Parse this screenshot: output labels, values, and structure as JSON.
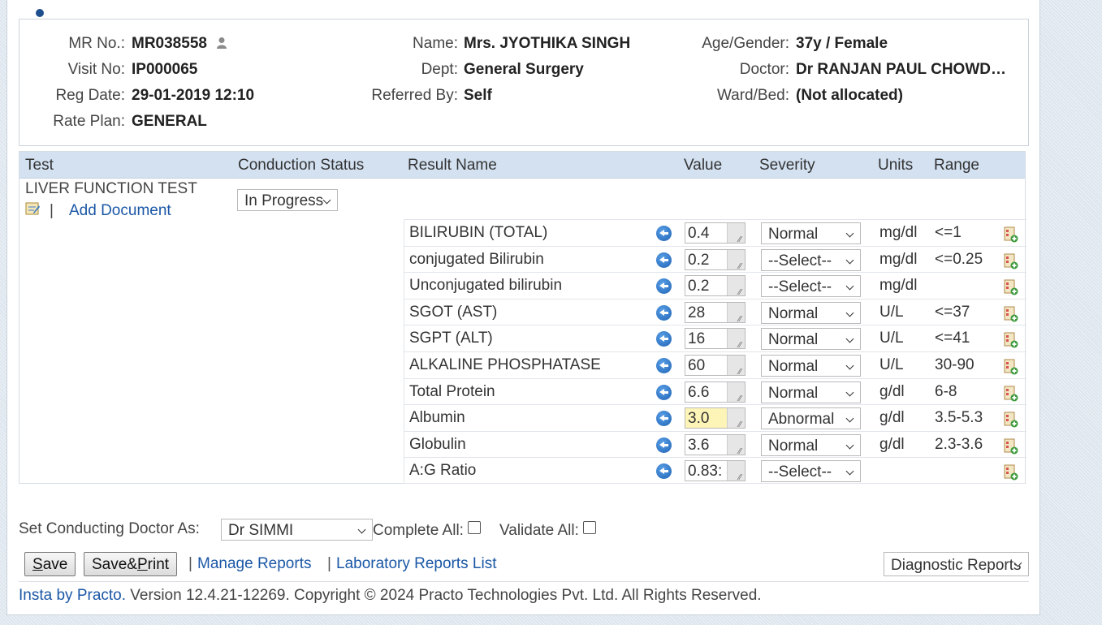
{
  "patient": {
    "mr_label": "MR No.:",
    "mr_value": "MR038558",
    "visit_label": "Visit No:",
    "visit_value": "IP000065",
    "reg_label": "Reg Date:",
    "reg_value": "29-01-2019 12:10",
    "rate_label": "Rate Plan:",
    "rate_value": "GENERAL",
    "name_label": "Name:",
    "name_value": "Mrs. JYOTHIKA SINGH",
    "dept_label": "Dept:",
    "dept_value": "General Surgery",
    "ref_label": "Referred By:",
    "ref_value": "Self",
    "age_label": "Age/Gender:",
    "age_value": "37y / Female",
    "doctor_label": "Doctor:",
    "doctor_value": "Dr RANJAN PAUL CHOWD…",
    "ward_label": "Ward/Bed:",
    "ward_value": "(Not allocated)"
  },
  "grid": {
    "headers": {
      "test": "Test",
      "status": "Conduction Status",
      "result": "Result Name",
      "value": "Value",
      "severity": "Severity",
      "units": "Units",
      "range": "Range"
    },
    "test_name": "LIVER FUNCTION TEST",
    "separator": "|",
    "add_document": "Add Document",
    "conduction_status": "In Progress",
    "rows": [
      {
        "name": "BILIRUBIN (TOTAL)",
        "value": "0.4",
        "severity": "Normal",
        "units": "mg/dl",
        "range": "<=1"
      },
      {
        "name": "conjugated Bilirubin",
        "value": "0.2",
        "severity": "--Select--",
        "units": "mg/dl",
        "range": "<=0.25"
      },
      {
        "name": "Unconjugated bilirubin",
        "value": "0.2",
        "severity": "--Select--",
        "units": "mg/dl",
        "range": ""
      },
      {
        "name": "SGOT (AST)",
        "value": "28",
        "severity": "Normal",
        "units": "U/L",
        "range": "<=37"
      },
      {
        "name": "SGPT (ALT)",
        "value": "16",
        "severity": "Normal",
        "units": "U/L",
        "range": "<=41"
      },
      {
        "name": "ALKALINE PHOSPHATASE",
        "value": "60",
        "severity": "Normal",
        "units": "U/L",
        "range": "30-90"
      },
      {
        "name": "Total Protein",
        "value": "6.6",
        "severity": "Normal",
        "units": "g/dl",
        "range": "6-8"
      },
      {
        "name": "Albumin",
        "value": "3.0",
        "severity": "Abnormal",
        "units": "g/dl",
        "range": "3.5-5.3",
        "highlight": true
      },
      {
        "name": "Globulin",
        "value": "3.6",
        "severity": "Normal",
        "units": "g/dl",
        "range": "2.3-3.6"
      },
      {
        "name": "A:G Ratio",
        "value": "0.83:",
        "severity": "--Select--",
        "units": "",
        "range": ""
      }
    ]
  },
  "footer": {
    "conducting_label": "Set Conducting Doctor As:",
    "conducting_value": "Dr SIMMI",
    "complete_all": "Complete All:",
    "validate_all": "Validate All:",
    "save_first": "S",
    "save_rest": "ave",
    "saveprint_a": "Save&",
    "saveprint_u": "P",
    "saveprint_b": "rint",
    "sep": "|",
    "manage_reports": "Manage Reports",
    "lab_reports_list": "Laboratory Reports List",
    "report_type": "Diagnostic Reports",
    "brand_link": "Insta by Practo.",
    "version_text": "Version 12.4.21-12269. Copyright © 2024 Practo Technologies Pvt. Ltd. All Rights Reserved."
  },
  "colors": {
    "highlight": "#fdf4b8",
    "link": "#1b57a6",
    "header_bg": "#d3e1f1"
  }
}
